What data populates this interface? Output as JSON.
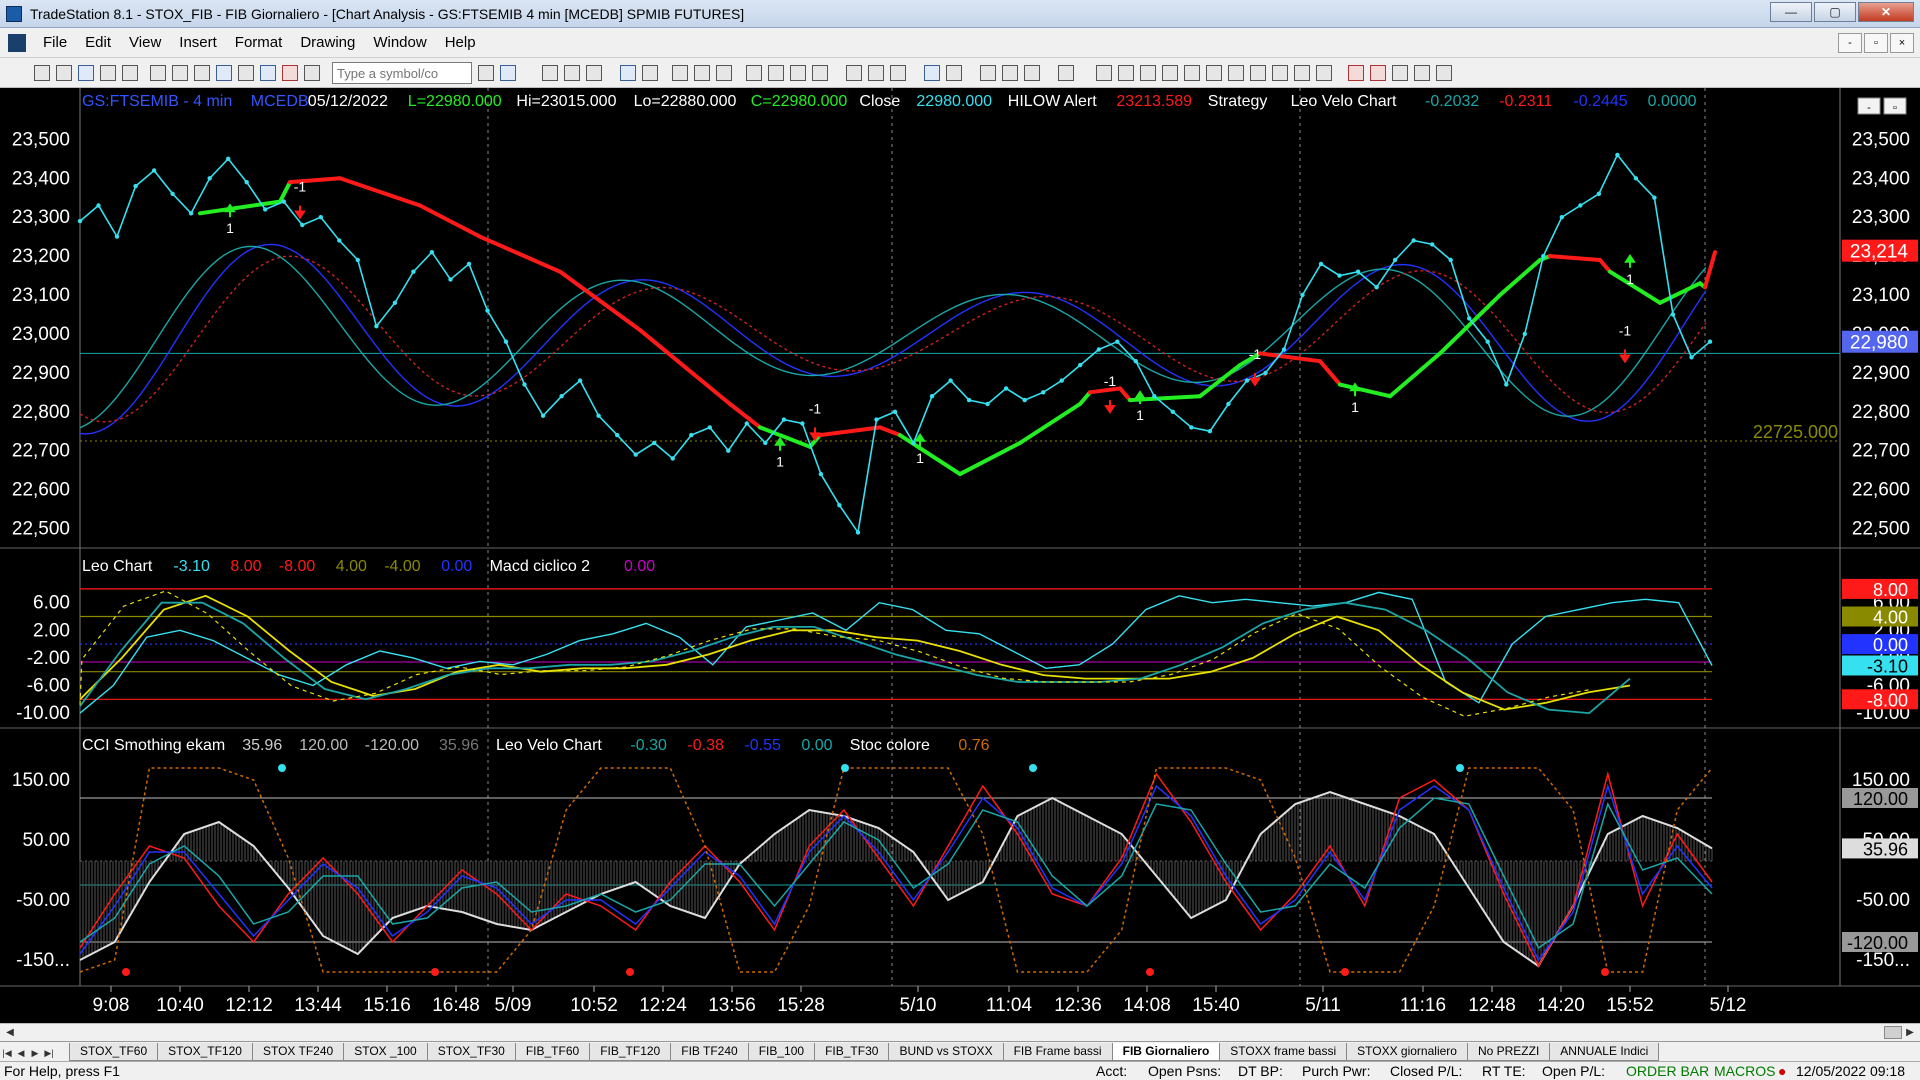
{
  "window": {
    "title": "TradeStation 8.1 - STOX_FIB - FIB Giornaliero - [Chart Analysis - GS:FTSEMIB  4 min  [MCEDB] SPMIB FUTURES]"
  },
  "titlebar_buttons": {
    "minimize": "—",
    "maximize": "▢",
    "close": "✕"
  },
  "menu": {
    "items": [
      "File",
      "Edit",
      "View",
      "Insert",
      "Format",
      "Drawing",
      "Window",
      "Help"
    ]
  },
  "mdi_buttons": {
    "minimize": "-",
    "restore": "▫",
    "close": "×"
  },
  "toolbar": {
    "symbol_placeholder": "Type a symbol/co"
  },
  "chart_panel_buttons": {
    "minimize": "-",
    "restore": "▫"
  },
  "colors": {
    "price": "#35e0f0",
    "ma_red": "#ff1a1a",
    "ma_green": "#22ee22",
    "osc_blue": "#2233ff",
    "osc_teal": "#1aa6a6",
    "yellow": "#e8e000",
    "orange": "#d06a00",
    "olive": "#8a8a00",
    "magenta": "#cc00cc",
    "grid": "#888888"
  },
  "chart_data": [
    {
      "type": "line",
      "title": "GS:FTSEMIB - 4 min",
      "header": [
        {
          "text": "GS:FTSEMIB - 4 min",
          "color": "#3355ff"
        },
        {
          "text": "MCEDB",
          "color": "#3355ff"
        },
        {
          "text": "05/12/2022",
          "color": "#ffffff"
        },
        {
          "text": "L=22980.000",
          "color": "#22ee22"
        },
        {
          "text": "Hi=23015.000",
          "color": "#ffffff"
        },
        {
          "text": "Lo=22880.000",
          "color": "#ffffff"
        },
        {
          "text": "C=22980.000",
          "color": "#22ee22"
        },
        {
          "text": "Close",
          "color": "#ffffff"
        },
        {
          "text": "22980.000",
          "color": "#35e0f0"
        },
        {
          "text": "HILOW Alert",
          "color": "#ffffff"
        },
        {
          "text": "23213.589",
          "color": "#ff1a1a"
        },
        {
          "text": "Strategy",
          "color": "#ffffff"
        },
        {
          "text": "Leo Velo Chart",
          "color": "#ffffff"
        },
        {
          "text": "-0.2032",
          "color": "#1aa6a6"
        },
        {
          "text": "-0.2311",
          "color": "#ff1a1a"
        },
        {
          "text": "-0.2445",
          "color": "#2233ff"
        },
        {
          "text": "0.0000",
          "color": "#1aa6a6"
        }
      ],
      "y_ticks": [
        "23,500",
        "23,400",
        "23,300",
        "23,200",
        "23,100",
        "23,000",
        "22,900",
        "22,800",
        "22,700",
        "22,600",
        "22,500"
      ],
      "ylim": [
        22450,
        23560
      ],
      "hline_label": "22725.000",
      "hline_value": 22725,
      "teal_hline_value": 22950,
      "price_tags": [
        {
          "text": "23,214",
          "value": 23214,
          "bg": "#ff1a1a",
          "fg": "#ffffff"
        },
        {
          "text": "22,980",
          "value": 22980,
          "bg": "#5566ee",
          "fg": "#ffffff"
        }
      ],
      "markers_text": [
        "1",
        "-1"
      ],
      "price_series": {
        "name": "Close",
        "x": [
          0,
          20,
          40,
          60,
          80,
          100,
          120,
          140,
          160,
          180,
          200,
          220,
          240,
          260,
          280,
          300,
          320,
          340,
          360,
          380,
          400,
          420,
          440,
          460,
          480,
          500,
          520,
          540,
          560,
          580,
          600,
          620,
          640,
          660,
          680,
          700,
          720,
          740,
          760,
          780,
          800,
          820,
          840,
          860,
          880,
          900,
          920,
          940,
          960,
          980,
          1000,
          1020,
          1040,
          1060,
          1080,
          1100,
          1120,
          1140,
          1160,
          1180,
          1200,
          1220,
          1240,
          1260,
          1280,
          1300,
          1320,
          1330,
          1340,
          1345,
          1350,
          1360
        ],
        "values": [
          23290,
          23330,
          23250,
          23380,
          23420,
          23360,
          23310,
          23400,
          23450,
          23390,
          23320,
          23340,
          23280,
          23300,
          23240,
          23190,
          23020,
          23080,
          23160,
          23210,
          23140,
          23180,
          23060,
          22980,
          22870,
          22790,
          22840,
          22880,
          22790,
          22740,
          22690,
          22720,
          22680,
          22740,
          22760,
          22700,
          22770,
          22720,
          22780,
          22770,
          22640,
          22560,
          22490,
          22780,
          22800,
          22720,
          22840,
          22880,
          22830,
          22820,
          22860,
          22830,
          22850,
          22880,
          22920,
          22960,
          22980,
          22930,
          22840,
          22800,
          22760,
          22750,
          22820,
          22880,
          22900,
          22960,
          23100,
          23180,
          23150,
          23160,
          23120,
          23190,
          23240,
          23230,
          23190,
          23040,
          22980,
          22870,
          23000,
          23200,
          23300,
          23330,
          23360,
          23460,
          23400,
          23350,
          23050,
          22940,
          22980
        ]
      },
      "price_series_xmax": 1335,
      "red_ma_segments": [
        {
          "values": [
            23390,
            23330,
            23280,
            23220,
            23160,
            23100,
            23030,
            22960,
            22900,
            22830,
            22780
          ],
          "color": "#ff1a1a"
        },
        {
          "values": [
            22735,
            22710,
            22700,
            22710,
            22735
          ],
          "color": "#22ee22"
        },
        {
          "values": [
            22770,
            22760,
            22760,
            22750
          ],
          "color": "#ff1a1a"
        }
      ]
    },
    {
      "type": "line",
      "title": "Leo Chart",
      "header": [
        {
          "text": "Leo Chart",
          "color": "#ffffff"
        },
        {
          "text": "-3.10",
          "color": "#35e0f0"
        },
        {
          "text": "8.00",
          "color": "#ff1a1a"
        },
        {
          "text": "-8.00",
          "color": "#ff1a1a"
        },
        {
          "text": "4.00",
          "color": "#8a8a00"
        },
        {
          "text": "-4.00",
          "color": "#8a8a00"
        },
        {
          "text": "0.00",
          "color": "#2233ff"
        },
        {
          "text": "Macd ciclico 2",
          "color": "#ffffff"
        },
        {
          "text": "0.00",
          "color": "#cc00cc"
        }
      ],
      "y_ticks": [
        "6.00",
        "2.00",
        "-2.00",
        "-6.00",
        "-10.00"
      ],
      "ylim": [
        -11,
        9
      ],
      "value_tags": [
        {
          "text": "8.00",
          "bg": "#ff1a1a",
          "fg": "#ffffff"
        },
        {
          "text": "4.00",
          "bg": "#8a8a00",
          "fg": "#ffffff"
        },
        {
          "text": "0.00",
          "bg": "#2233ff",
          "fg": "#ffffff"
        },
        {
          "text": "-3.10",
          "bg": "#35e0f0",
          "fg": "#000000"
        },
        {
          "text": "-8.00",
          "bg": "#ff1a1a",
          "fg": "#ffffff"
        }
      ],
      "series": [
        {
          "name": "Leo Chart",
          "color": "#35e0f0",
          "values": [
            -10,
            -6,
            1,
            2,
            0.5,
            -2,
            -4.5,
            -6,
            -3,
            -1,
            -2,
            -3.5,
            -2.5,
            -3,
            -1.5,
            0.5,
            1.5,
            3,
            1,
            -3,
            2.5,
            3.5,
            4.5,
            2,
            6,
            5,
            2,
            1.5,
            -1,
            -3.5,
            -3,
            0,
            5,
            7,
            6,
            6.5,
            6,
            5.5,
            6,
            7.5,
            6.5,
            -5.5,
            -8.5,
            0,
            4,
            5,
            6,
            6.5,
            6,
            -3.1
          ]
        },
        {
          "name": "",
          "color": "#e8e000",
          "dash": false,
          "values": [
            -8,
            -2,
            5,
            7,
            4,
            -1,
            -5.5,
            -7.5,
            -6.5,
            -4,
            -3,
            -4,
            -3.5,
            -3.5,
            -3,
            -1.5,
            0.5,
            2,
            2,
            1,
            0.5,
            -1,
            -3,
            -4.5,
            -5,
            -5,
            -5,
            -4,
            -2,
            1.5,
            4,
            2,
            -3,
            -7,
            -9.5,
            -8.5,
            -7,
            -6
          ]
        },
        {
          "name": "",
          "color": "#1aa6a6",
          "dash": false,
          "values": [
            -9,
            -1,
            6,
            6,
            3,
            -2,
            -6.5,
            -8,
            -6.5,
            -4.5,
            -3.5,
            -3.5,
            -3,
            -3,
            -2.5,
            -1,
            1,
            2.5,
            2.5,
            0.5,
            -1.5,
            -3,
            -4.5,
            -5.5,
            -5.5,
            -5.5,
            -5,
            -3,
            -0.5,
            3,
            5,
            6,
            5,
            2,
            -2,
            -7,
            -9.5,
            -10,
            -5
          ]
        }
      ]
    },
    {
      "type": "line",
      "title": "CCI Smothing ekam",
      "header": [
        {
          "text": "CCI Smothing ekam",
          "color": "#ffffff"
        },
        {
          "text": "35.96",
          "color": "#cccccc"
        },
        {
          "text": "120.00",
          "color": "#bbbbbb"
        },
        {
          "text": "-120.00",
          "color": "#bbbbbb"
        },
        {
          "text": "35.96",
          "color": "#777777"
        },
        {
          "text": "Leo Velo Chart",
          "color": "#ffffff"
        },
        {
          "text": "-0.30",
          "color": "#1aa6a6"
        },
        {
          "text": "-0.38",
          "color": "#ff1a1a"
        },
        {
          "text": "-0.55",
          "color": "#2233ff"
        },
        {
          "text": "0.00",
          "color": "#1aa6a6"
        },
        {
          "text": "Stoc colore",
          "color": "#ffffff"
        },
        {
          "text": "0.76",
          "color": "#d06a00"
        }
      ],
      "y_ticks": [
        "150.00",
        "50.00",
        "-50.00",
        "-150..."
      ],
      "ylim": [
        -180,
        190
      ],
      "value_tags": [
        {
          "text": "120.00",
          "bg": "#999999",
          "fg": "#000000"
        },
        {
          "text": "35.96",
          "bg": "#dddddd",
          "fg": "#000000"
        },
        {
          "text": "-120.00",
          "bg": "#999999",
          "fg": "#000000"
        }
      ],
      "series": [
        {
          "name": "CCI Smothing ekam",
          "color": "#dddddd",
          "values": [
            -150,
            -120,
            -20,
            60,
            80,
            40,
            -30,
            -110,
            -140,
            -80,
            -60,
            -70,
            -90,
            -100,
            -70,
            -40,
            -20,
            -60,
            -80,
            10,
            60,
            100,
            90,
            70,
            30,
            -50,
            -20,
            90,
            120,
            90,
            60,
            -10,
            -80,
            -50,
            60,
            110,
            130,
            110,
            90,
            60,
            -30,
            -120,
            -160,
            -60,
            60,
            90,
            70,
            35.96
          ]
        },
        {
          "name": "",
          "color": "#ff1a1a",
          "values": [
            -130,
            -40,
            40,
            20,
            -60,
            -120,
            -40,
            20,
            -40,
            -120,
            -60,
            0,
            -40,
            -100,
            -40,
            -60,
            -100,
            -20,
            40,
            -20,
            -100,
            40,
            100,
            20,
            -60,
            40,
            140,
            60,
            -40,
            -60,
            20,
            160,
            80,
            -20,
            -100,
            -40,
            40,
            -60,
            120,
            150,
            100,
            -40,
            -160,
            -60,
            160,
            -60,
            60,
            -20
          ]
        },
        {
          "name": "",
          "color": "#2233ff",
          "values": [
            -140,
            -60,
            30,
            30,
            -40,
            -110,
            -50,
            10,
            -30,
            -110,
            -70,
            -10,
            -30,
            -90,
            -50,
            -50,
            -90,
            -30,
            30,
            -10,
            -90,
            30,
            90,
            30,
            -50,
            30,
            120,
            70,
            -30,
            -60,
            10,
            140,
            90,
            -10,
            -90,
            -50,
            30,
            -50,
            100,
            140,
            100,
            -30,
            -150,
            -70,
            140,
            -40,
            40,
            -30
          ]
        },
        {
          "name": "",
          "color": "#1aa6a6",
          "values": [
            -120,
            -80,
            10,
            40,
            -10,
            -90,
            -70,
            -10,
            -10,
            -90,
            -80,
            -30,
            -20,
            -70,
            -60,
            -40,
            -70,
            -50,
            10,
            10,
            -60,
            10,
            80,
            50,
            -30,
            10,
            100,
            80,
            -10,
            -60,
            -10,
            110,
            100,
            10,
            -70,
            -60,
            10,
            -30,
            70,
            120,
            110,
            -10,
            -130,
            -90,
            110,
            0,
            20,
            -40
          ]
        },
        {
          "name": "Stoc colore",
          "color": "#d06a00",
          "values": [
            -170,
            -150,
            170,
            170,
            170,
            150,
            20,
            -170,
            -170,
            -170,
            -170,
            -170,
            -170,
            -100,
            100,
            170,
            170,
            170,
            40,
            -170,
            -170,
            -60,
            170,
            170,
            170,
            170,
            60,
            -170,
            -170,
            -170,
            -100,
            170,
            170,
            170,
            150,
            20,
            -170,
            -170,
            -170,
            -60,
            170,
            170,
            170,
            100,
            -170,
            -170,
            100,
            170
          ]
        }
      ],
      "zero_line_value": 15,
      "upper_band": 120,
      "lower_band": -120,
      "mid_band": -25
    }
  ],
  "time_axis": {
    "labels": [
      "9:08",
      "10:40",
      "12:12",
      "13:44",
      "15:16",
      "16:48",
      "5/09",
      "10:52",
      "12:24",
      "13:56",
      "15:28",
      "5/10",
      "11:04",
      "12:36",
      "14:08",
      "15:40",
      "5/11",
      "11:16",
      "12:48",
      "14:20",
      "15:52",
      "5/12"
    ]
  },
  "tabs": [
    "STOX_TF60",
    "STOX_TF120",
    "STOX TF240",
    "STOX _100",
    "STOX_TF30",
    "FIB_TF60",
    "FIB_TF120",
    "FIB TF240",
    "FIB_100",
    "FIB_TF30",
    "BUND vs STOXX",
    "FIB Frame bassi",
    "FIB Giornaliero",
    "STOXX frame bassi",
    "STOXX giornaliero",
    "No PREZZI",
    "ANNUALE Indici"
  ],
  "active_tab": "FIB Giornaliero",
  "status": {
    "help": "For Help, press F1",
    "acct": "Acct:",
    "open_psns": "Open Psns:",
    "dt_bp": "DT BP:",
    "purch_pwr": "Purch Pwr:",
    "closed_pl": "Closed P/L:",
    "rt_te": "RT TE:",
    "open_pl": "Open P/L:",
    "order_bar": "ORDER BAR",
    "macros": "MACROS",
    "datetime": "12/05/2022 09:18"
  }
}
